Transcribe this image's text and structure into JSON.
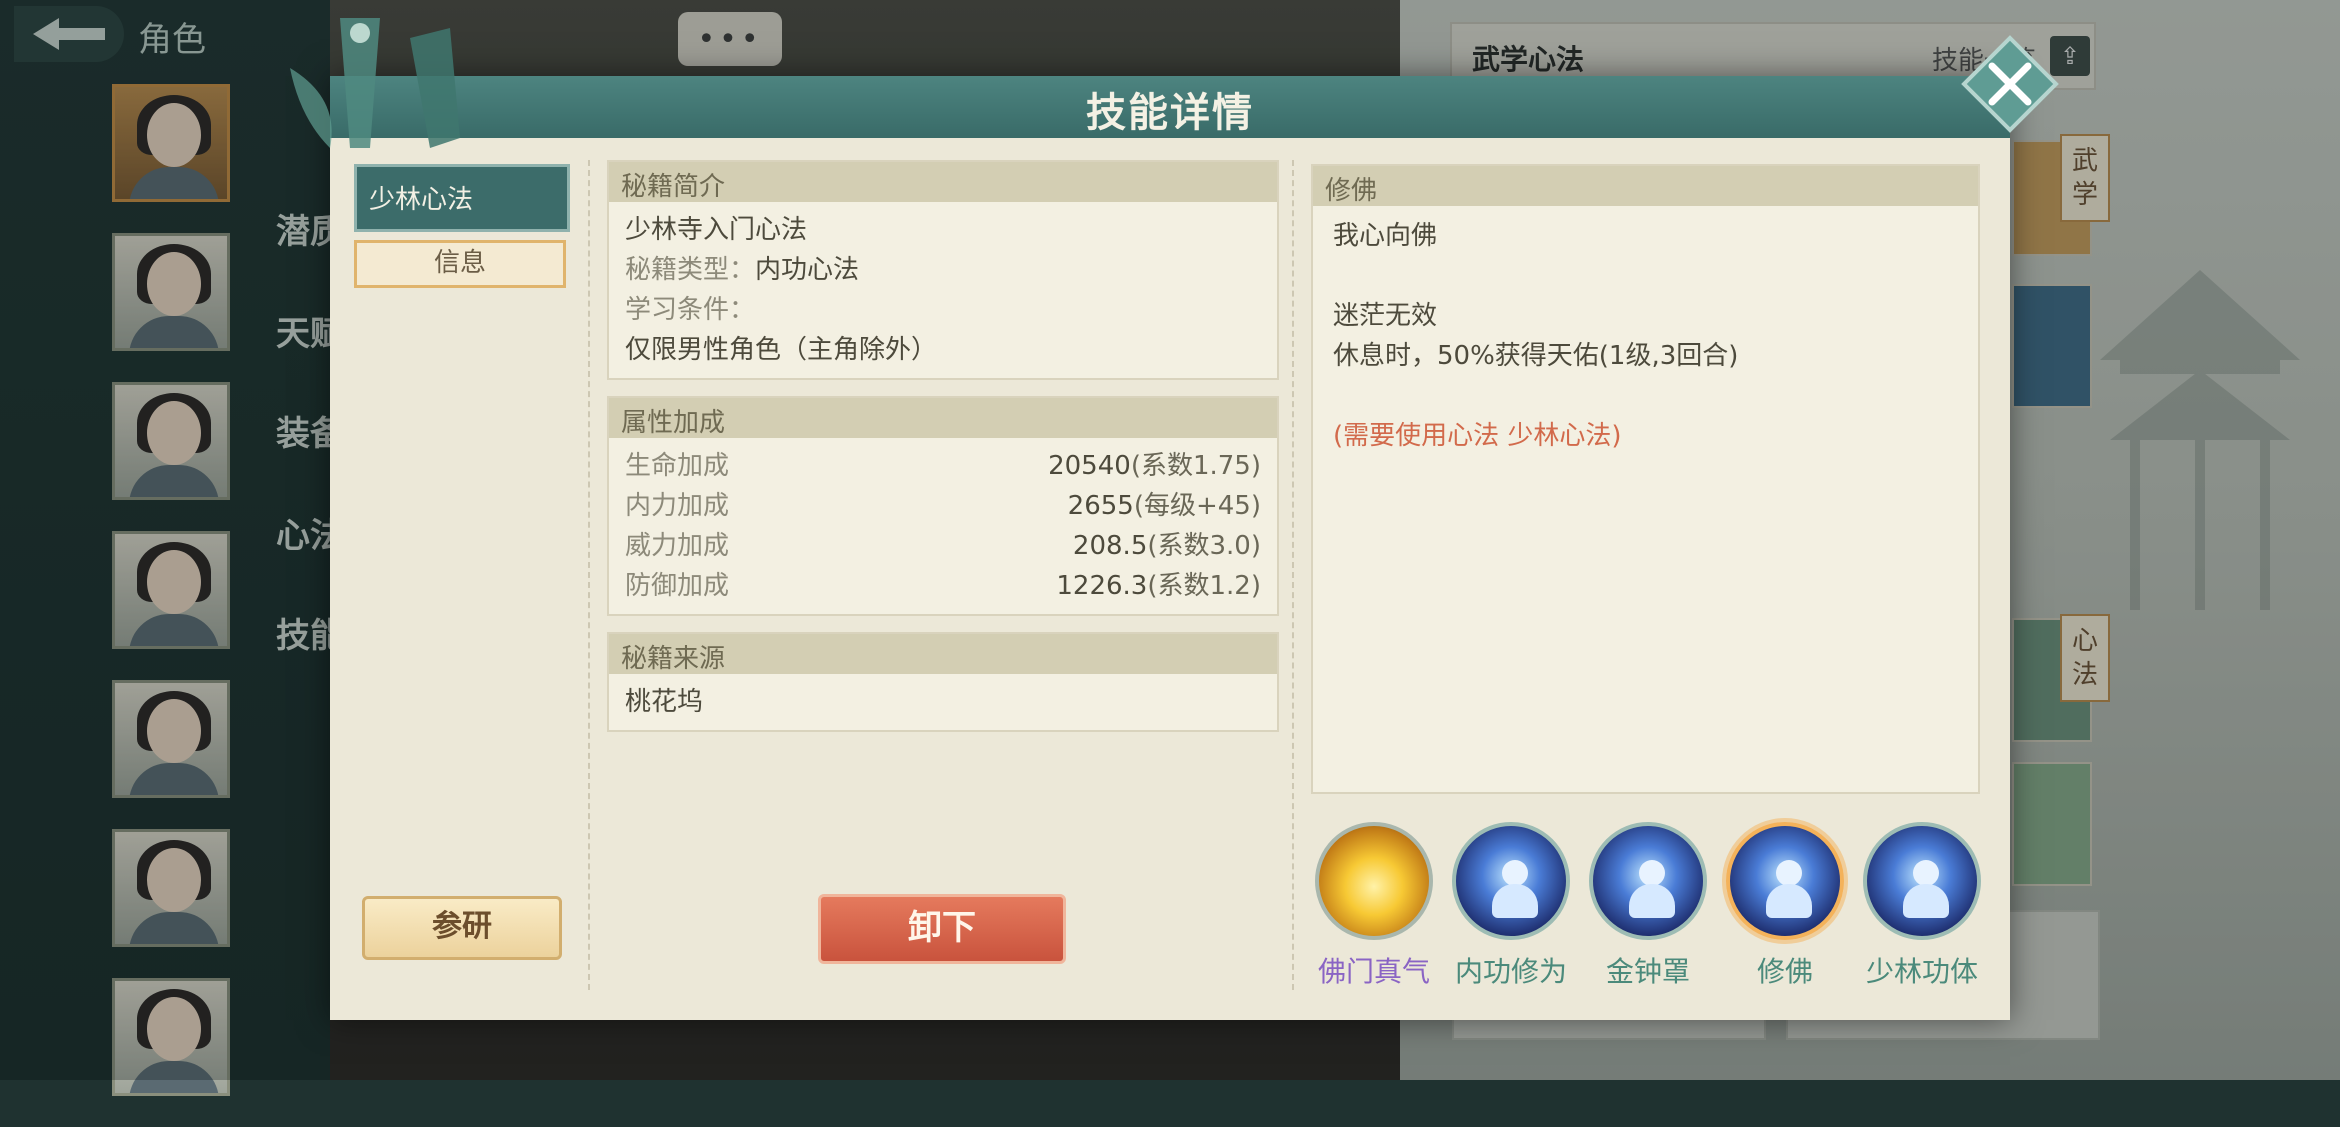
{
  "background": {
    "back_label": "角色",
    "side_tabs": [
      "潜质",
      "天赋",
      "装备",
      "心法",
      "技能"
    ],
    "chat_icon": "chat-bubble-icon",
    "right_header": {
      "title": "武学心法",
      "text": "技能一览"
    },
    "right_tags": [
      "武学",
      "心法"
    ]
  },
  "modal": {
    "title": "技能详情",
    "left_tabs": {
      "active": "少林心法",
      "info": "信息"
    },
    "research_button": "参研",
    "unload_button": "卸下",
    "intro": {
      "title": "秘籍简介",
      "name": "少林寺入门心法",
      "type_label": "秘籍类型：",
      "type_value": "内功心法",
      "condition_label": "学习条件：",
      "condition_value": "仅限男性角色（主角除外）"
    },
    "attributes": {
      "title": "属性加成",
      "rows": [
        {
          "label": "生命加成",
          "value": "20540",
          "note": "(系数1.75)"
        },
        {
          "label": "内力加成",
          "value": "2655",
          "note": "(每级+45)"
        },
        {
          "label": "威力加成",
          "value": "208.5",
          "note": "(系数3.0)"
        },
        {
          "label": "防御加成",
          "value": "1226.3",
          "note": "(系数1.2)"
        }
      ]
    },
    "source": {
      "title": "秘籍来源",
      "value": "桃花坞"
    },
    "detail": {
      "title": "修佛",
      "line1": "我心向佛",
      "line2": "迷茫无效",
      "line3": "休息时，50%获得天佑(1级,3回合)",
      "requirement": "(需要使用心法 少林心法)"
    },
    "skills": [
      {
        "name": "佛门真气",
        "icon": "golden-orb-icon"
      },
      {
        "name": "内功修为",
        "icon": "meditation-icon"
      },
      {
        "name": "金钟罩",
        "icon": "meditation-icon"
      },
      {
        "name": "修佛",
        "icon": "meditation-icon",
        "selected": true
      },
      {
        "name": "少林功体",
        "icon": "meditation-icon"
      }
    ]
  }
}
